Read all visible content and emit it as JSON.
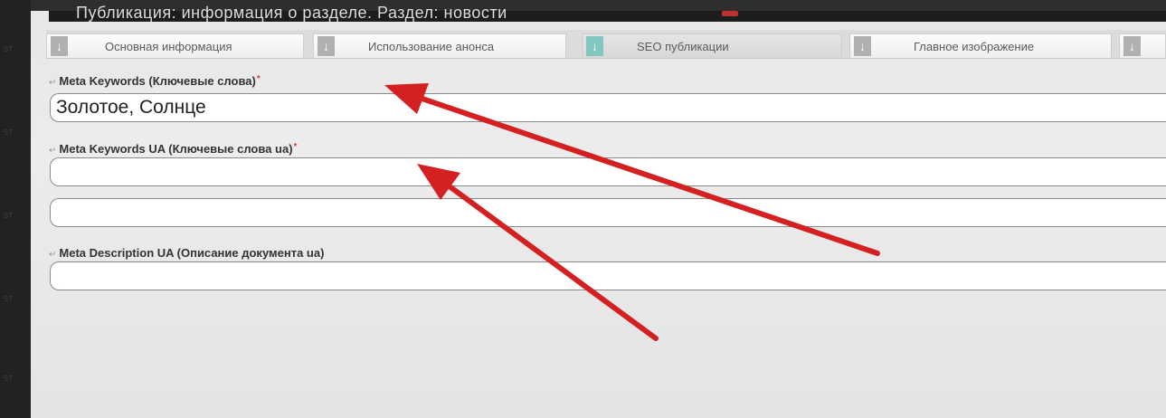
{
  "heading": {
    "text": "Публикация: информация о разделе. Раздел: новости"
  },
  "left_strip": {
    "marks": [
      "ST",
      "ST",
      "ST",
      "ST",
      "ST"
    ]
  },
  "tabs": [
    {
      "label": "Основная информация",
      "icon": "arrow-down-icon",
      "active": false
    },
    {
      "label": "Использование анонса",
      "icon": "arrow-down-icon",
      "active": false
    },
    {
      "label": "SEO публикации",
      "icon": "arrow-down-icon",
      "active": true
    },
    {
      "label": "Главное изображение",
      "icon": "arrow-down-icon",
      "active": false
    },
    {
      "label": "",
      "icon": "arrow-down-icon",
      "active": false
    }
  ],
  "fields": {
    "meta_keywords": {
      "label": "Meta Keywords (Ключевые слова)",
      "required_mark": "*",
      "value": "Золотое, Солнце"
    },
    "meta_keywords_ua": {
      "label": "Meta Keywords UA (Ключевые слова ua)",
      "required_mark": "*",
      "value": ""
    },
    "meta_description": {
      "value": ""
    },
    "meta_description_ua": {
      "label": "Meta Description UA (Описание документа ua)",
      "value": ""
    }
  },
  "annotation": {
    "arrow_color": "#d42020"
  },
  "colors": {
    "active_tab_icon": "#7fc7bf",
    "tab_icon": "#b0b0b0",
    "required": "#e0403a"
  }
}
